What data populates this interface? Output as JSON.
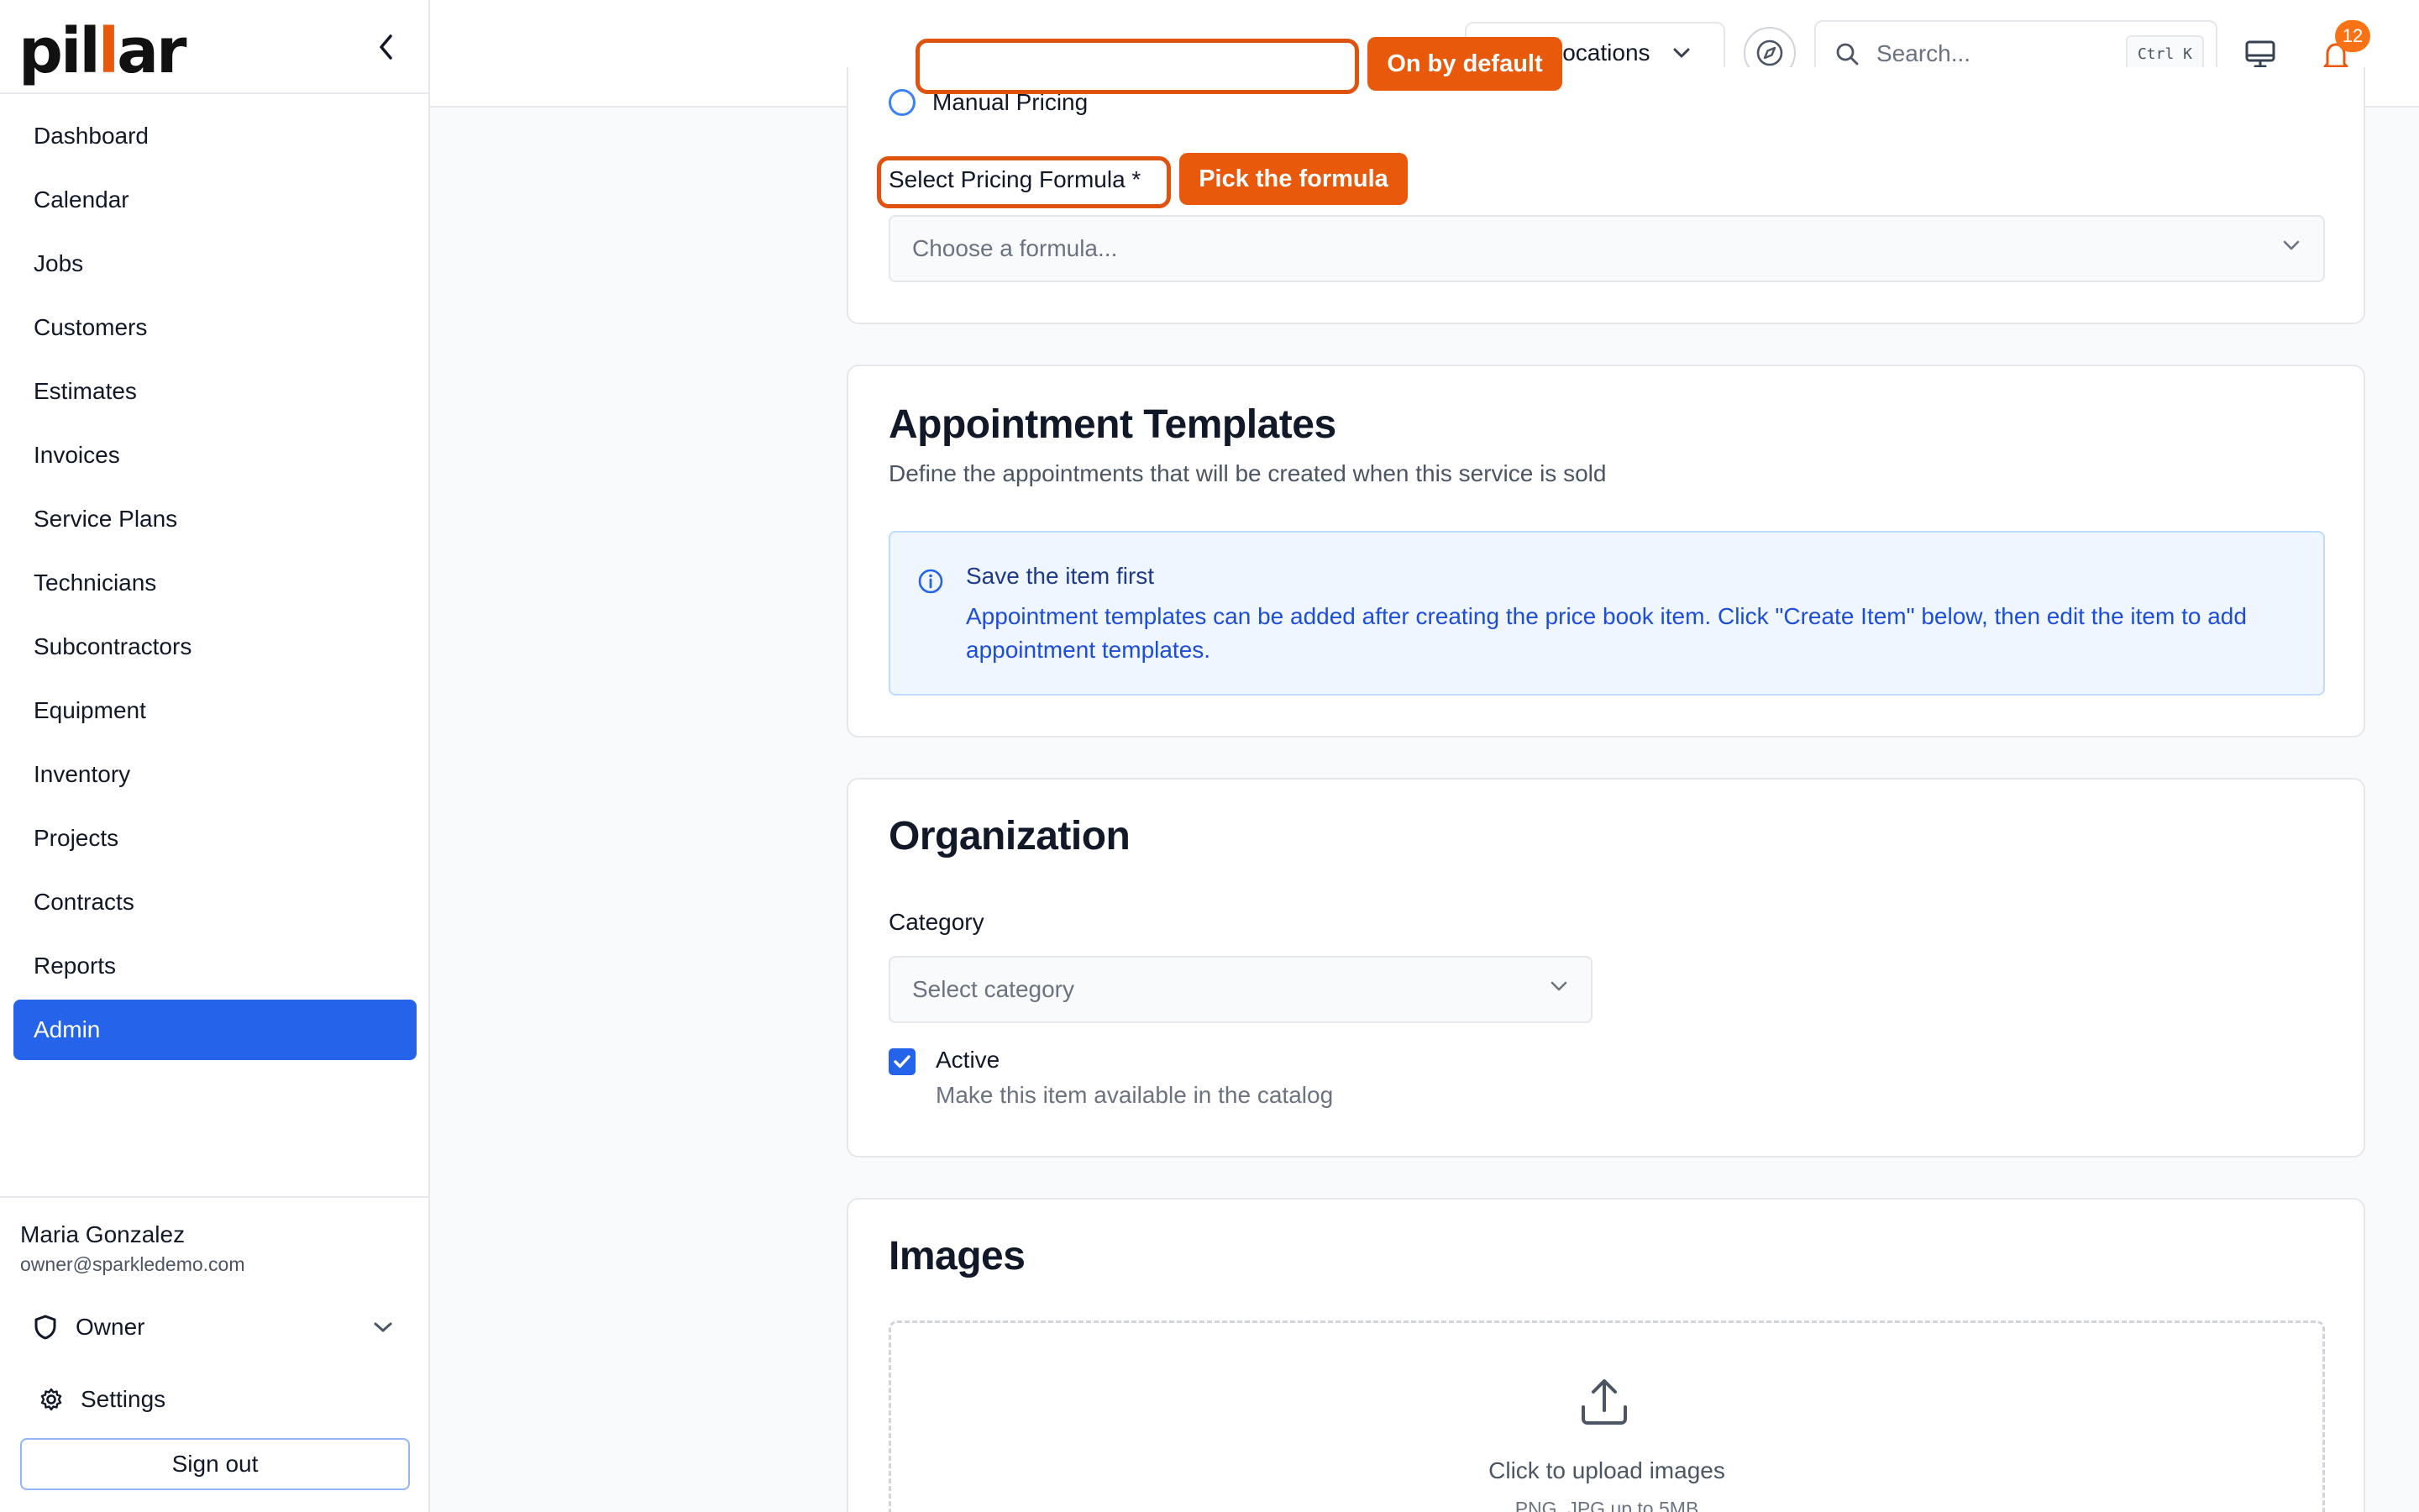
{
  "brand": {
    "prefix": "pil",
    "accent": "l",
    "suffix": "ar"
  },
  "sidebar": {
    "items": [
      {
        "label": "Dashboard"
      },
      {
        "label": "Calendar"
      },
      {
        "label": "Jobs"
      },
      {
        "label": "Customers"
      },
      {
        "label": "Estimates"
      },
      {
        "label": "Invoices"
      },
      {
        "label": "Service Plans"
      },
      {
        "label": "Technicians"
      },
      {
        "label": "Subcontractors"
      },
      {
        "label": "Equipment"
      },
      {
        "label": "Inventory"
      },
      {
        "label": "Projects"
      },
      {
        "label": "Contracts"
      },
      {
        "label": "Reports"
      },
      {
        "label": "Admin",
        "active": true
      }
    ],
    "user": {
      "name": "Maria Gonzalez",
      "email": "owner@sparkledemo.com"
    },
    "role": "Owner",
    "settings_label": "Settings",
    "signout_label": "Sign out"
  },
  "topbar": {
    "locations_label": "locations",
    "search_placeholder": "Search...",
    "search_shortcut": "Ctrl K",
    "notification_count": "12"
  },
  "pricing": {
    "radio_label": "Manual Pricing",
    "formula_label": "Select Pricing Formula *",
    "formula_placeholder": "Choose a formula..."
  },
  "appointments": {
    "title": "Appointment Templates",
    "subtitle": "Define the appointments that will be created when this service is sold",
    "info_title": "Save the item first",
    "info_body": "Appointment templates can be added after creating the price book item. Click \"Create Item\" below, then edit the item to add appointment templates."
  },
  "organization": {
    "title": "Organization",
    "category_label": "Category",
    "category_placeholder": "Select category",
    "active_label": "Active",
    "active_checked": true,
    "active_desc": "Make this item available in the catalog"
  },
  "images": {
    "title": "Images",
    "upload_text": "Click to upload images",
    "upload_hint": "PNG, JPG up to 5MB"
  },
  "annotations": {
    "callout_default": "On by default",
    "callout_formula": "Pick the formula"
  },
  "colors": {
    "primary": "#2563eb",
    "annotation": "#e8590c",
    "badge": "#f97316",
    "info_bg": "#eff6ff"
  }
}
